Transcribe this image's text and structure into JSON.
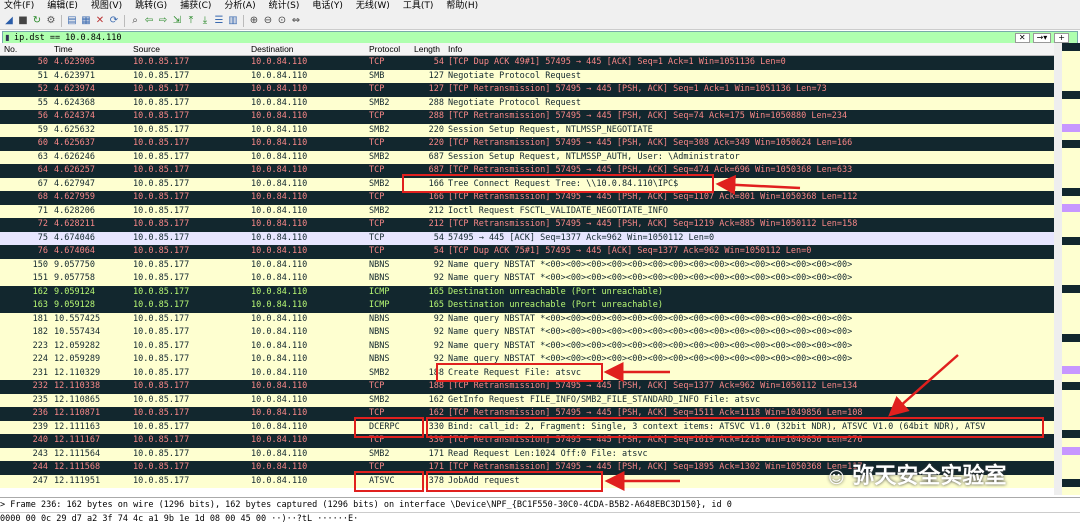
{
  "menu": [
    "文件(F)",
    "编辑(E)",
    "视图(V)",
    "跳转(G)",
    "捕获(C)",
    "分析(A)",
    "统计(S)",
    "电话(Y)",
    "无线(W)",
    "工具(T)",
    "帮助(H)"
  ],
  "filter": {
    "value": "ip.dst == 10.0.84.110"
  },
  "columns": [
    "No.",
    "Time",
    "Source",
    "Destination",
    "Protocol",
    "Length",
    "Info"
  ],
  "packets": [
    {
      "no": "50",
      "time": "4.623905",
      "src": "10.0.85.177",
      "dst": "10.0.84.110",
      "proto": "TCP",
      "len": "54",
      "info": "[TCP Dup ACK 49#1] 57495 → 445 [ACK] Seq=1 Ack=1 Win=1051136 Len=0",
      "cls": "c-tcp-bad"
    },
    {
      "no": "51",
      "time": "4.623971",
      "src": "10.0.85.177",
      "dst": "10.0.84.110",
      "proto": "SMB",
      "len": "127",
      "info": "Negotiate Protocol Request",
      "cls": "c-smb"
    },
    {
      "no": "52",
      "time": "4.623974",
      "src": "10.0.85.177",
      "dst": "10.0.84.110",
      "proto": "TCP",
      "len": "127",
      "info": "[TCP Retransmission] 57495 → 445 [PSH, ACK] Seq=1 Ack=1 Win=1051136 Len=73",
      "cls": "c-tcp-bad"
    },
    {
      "no": "55",
      "time": "4.624368",
      "src": "10.0.85.177",
      "dst": "10.0.84.110",
      "proto": "SMB2",
      "len": "288",
      "info": "Negotiate Protocol Request",
      "cls": "c-smb"
    },
    {
      "no": "56",
      "time": "4.624374",
      "src": "10.0.85.177",
      "dst": "10.0.84.110",
      "proto": "TCP",
      "len": "288",
      "info": "[TCP Retransmission] 57495 → 445 [PSH, ACK] Seq=74 Ack=175 Win=1050880 Len=234",
      "cls": "c-tcp-bad"
    },
    {
      "no": "59",
      "time": "4.625632",
      "src": "10.0.85.177",
      "dst": "10.0.84.110",
      "proto": "SMB2",
      "len": "220",
      "info": "Session Setup Request, NTLMSSP_NEGOTIATE",
      "cls": "c-smb"
    },
    {
      "no": "60",
      "time": "4.625637",
      "src": "10.0.85.177",
      "dst": "10.0.84.110",
      "proto": "TCP",
      "len": "220",
      "info": "[TCP Retransmission] 57495 → 445 [PSH, ACK] Seq=308 Ack=349 Win=1050624 Len=166",
      "cls": "c-tcp-bad"
    },
    {
      "no": "63",
      "time": "4.626246",
      "src": "10.0.85.177",
      "dst": "10.0.84.110",
      "proto": "SMB2",
      "len": "687",
      "info": "Session Setup Request, NTLMSSP_AUTH, User: \\Administrator",
      "cls": "c-smb"
    },
    {
      "no": "64",
      "time": "4.626257",
      "src": "10.0.85.177",
      "dst": "10.0.84.110",
      "proto": "TCP",
      "len": "687",
      "info": "[TCP Retransmission] 57495 → 445 [PSH, ACK] Seq=474 Ack=696 Win=1050368 Len=633",
      "cls": "c-tcp-bad"
    },
    {
      "no": "67",
      "time": "4.627947",
      "src": "10.0.85.177",
      "dst": "10.0.84.110",
      "proto": "SMB2",
      "len": "166",
      "info": "Tree Connect Request Tree: \\\\10.0.84.110\\IPC$",
      "cls": "c-smb"
    },
    {
      "no": "68",
      "time": "4.627959",
      "src": "10.0.85.177",
      "dst": "10.0.84.110",
      "proto": "TCP",
      "len": "166",
      "info": "[TCP Retransmission] 57495 → 445 [PSH, ACK] Seq=1107 Ack=801 Win=1050368 Len=112",
      "cls": "c-tcp-bad"
    },
    {
      "no": "71",
      "time": "4.628206",
      "src": "10.0.85.177",
      "dst": "10.0.84.110",
      "proto": "SMB2",
      "len": "212",
      "info": "Ioctl Request FSCTL_VALIDATE_NEGOTIATE_INFO",
      "cls": "c-smb"
    },
    {
      "no": "72",
      "time": "4.628211",
      "src": "10.0.85.177",
      "dst": "10.0.84.110",
      "proto": "TCP",
      "len": "212",
      "info": "[TCP Retransmission] 57495 → 445 [PSH, ACK] Seq=1219 Ack=885 Win=1050112 Len=158",
      "cls": "c-tcp-bad"
    },
    {
      "no": "75",
      "time": "4.674046",
      "src": "10.0.85.177",
      "dst": "10.0.84.110",
      "proto": "TCP",
      "len": "54",
      "info": "57495 → 445 [ACK] Seq=1377 Ack=962 Win=1050112 Len=0",
      "cls": "c-tcp"
    },
    {
      "no": "76",
      "time": "4.674064",
      "src": "10.0.85.177",
      "dst": "10.0.84.110",
      "proto": "TCP",
      "len": "54",
      "info": "[TCP Dup ACK 75#1] 57495 → 445 [ACK] Seq=1377 Ack=962 Win=1050112 Len=0",
      "cls": "c-tcp-bad"
    },
    {
      "no": "150",
      "time": "9.057750",
      "src": "10.0.85.177",
      "dst": "10.0.84.110",
      "proto": "NBNS",
      "len": "92",
      "info": "Name query NBSTAT *<00><00><00><00><00><00><00><00><00><00><00><00><00><00><00>",
      "cls": "c-nbns"
    },
    {
      "no": "151",
      "time": "9.057758",
      "src": "10.0.85.177",
      "dst": "10.0.84.110",
      "proto": "NBNS",
      "len": "92",
      "info": "Name query NBSTAT *<00><00><00><00><00><00><00><00><00><00><00><00><00><00><00>",
      "cls": "c-nbns"
    },
    {
      "no": "162",
      "time": "9.059124",
      "src": "10.0.85.177",
      "dst": "10.0.84.110",
      "proto": "ICMP",
      "len": "165",
      "info": "Destination unreachable (Port unreachable)",
      "cls": "c-icmp"
    },
    {
      "no": "163",
      "time": "9.059128",
      "src": "10.0.85.177",
      "dst": "10.0.84.110",
      "proto": "ICMP",
      "len": "165",
      "info": "Destination unreachable (Port unreachable)",
      "cls": "c-icmp"
    },
    {
      "no": "181",
      "time": "10.557425",
      "src": "10.0.85.177",
      "dst": "10.0.84.110",
      "proto": "NBNS",
      "len": "92",
      "info": "Name query NBSTAT *<00><00><00><00><00><00><00><00><00><00><00><00><00><00><00>",
      "cls": "c-nbns"
    },
    {
      "no": "182",
      "time": "10.557434",
      "src": "10.0.85.177",
      "dst": "10.0.84.110",
      "proto": "NBNS",
      "len": "92",
      "info": "Name query NBSTAT *<00><00><00><00><00><00><00><00><00><00><00><00><00><00><00>",
      "cls": "c-nbns"
    },
    {
      "no": "223",
      "time": "12.059282",
      "src": "10.0.85.177",
      "dst": "10.0.84.110",
      "proto": "NBNS",
      "len": "92",
      "info": "Name query NBSTAT *<00><00><00><00><00><00><00><00><00><00><00><00><00><00><00>",
      "cls": "c-nbns"
    },
    {
      "no": "224",
      "time": "12.059289",
      "src": "10.0.85.177",
      "dst": "10.0.84.110",
      "proto": "NBNS",
      "len": "92",
      "info": "Name query NBSTAT *<00><00><00><00><00><00><00><00><00><00><00><00><00><00><00>",
      "cls": "c-nbns"
    },
    {
      "no": "231",
      "time": "12.110329",
      "src": "10.0.85.177",
      "dst": "10.0.84.110",
      "proto": "SMB2",
      "len": "188",
      "info": "Create Request File: atsvc",
      "cls": "c-smb"
    },
    {
      "no": "232",
      "time": "12.110338",
      "src": "10.0.85.177",
      "dst": "10.0.84.110",
      "proto": "TCP",
      "len": "188",
      "info": "[TCP Retransmission] 57495 → 445 [PSH, ACK] Seq=1377 Ack=962 Win=1050112 Len=134",
      "cls": "c-tcp-bad"
    },
    {
      "no": "235",
      "time": "12.110865",
      "src": "10.0.85.177",
      "dst": "10.0.84.110",
      "proto": "SMB2",
      "len": "162",
      "info": "GetInfo Request FILE_INFO/SMB2_FILE_STANDARD_INFO File: atsvc",
      "cls": "c-smb"
    },
    {
      "no": "236",
      "time": "12.110871",
      "src": "10.0.85.177",
      "dst": "10.0.84.110",
      "proto": "TCP",
      "len": "162",
      "info": "[TCP Retransmission] 57495 → 445 [PSH, ACK] Seq=1511 Ack=1118 Win=1049856 Len=108",
      "cls": "c-tcp-bad"
    },
    {
      "no": "239",
      "time": "12.111163",
      "src": "10.0.85.177",
      "dst": "10.0.84.110",
      "proto": "DCERPC",
      "len": "330",
      "info": "Bind: call_id: 2, Fragment: Single, 3 context items: ATSVC V1.0 (32bit NDR), ATSVC V1.0 (64bit NDR), ATSV",
      "cls": "c-smb"
    },
    {
      "no": "240",
      "time": "12.111167",
      "src": "10.0.85.177",
      "dst": "10.0.84.110",
      "proto": "TCP",
      "len": "330",
      "info": "[TCP Retransmission] 57495 → 445 [PSH, ACK] Seq=1619 Ack=1218 Win=1049856 Len=276",
      "cls": "c-tcp-bad"
    },
    {
      "no": "243",
      "time": "12.111564",
      "src": "10.0.85.177",
      "dst": "10.0.84.110",
      "proto": "SMB2",
      "len": "171",
      "info": "Read Request Len:1024 Off:0 File: atsvc",
      "cls": "c-smb"
    },
    {
      "no": "244",
      "time": "12.111568",
      "src": "10.0.85.177",
      "dst": "10.0.84.110",
      "proto": "TCP",
      "len": "171",
      "info": "[TCP Retransmission] 57495 → 445 [PSH, ACK] Seq=1895 Ack=1302 Win=1050368 Len=117",
      "cls": "c-tcp-bad"
    },
    {
      "no": "247",
      "time": "12.111951",
      "src": "10.0.85.177",
      "dst": "10.0.84.110",
      "proto": "ATSVC",
      "len": "378",
      "info": "JobAdd request",
      "cls": "c-smb"
    }
  ],
  "detail": "Frame 236: 162 bytes on wire (1296 bits), 162 bytes captured (1296 bits) on interface \\Device\\NPF_{BC1F550-30C0-4CDA-B5B2-A648EBC3D150}, id 0",
  "bytes": "0000  00 0c 29 d7 a2 3f 74 4c  a1 9b 1e 1d 08 00 45 00   ··)··?tL ······E·",
  "watermark": "弥天安全实验室",
  "colors": {
    "accent_red": "#e0201e",
    "filter_green": "#afffaf"
  }
}
